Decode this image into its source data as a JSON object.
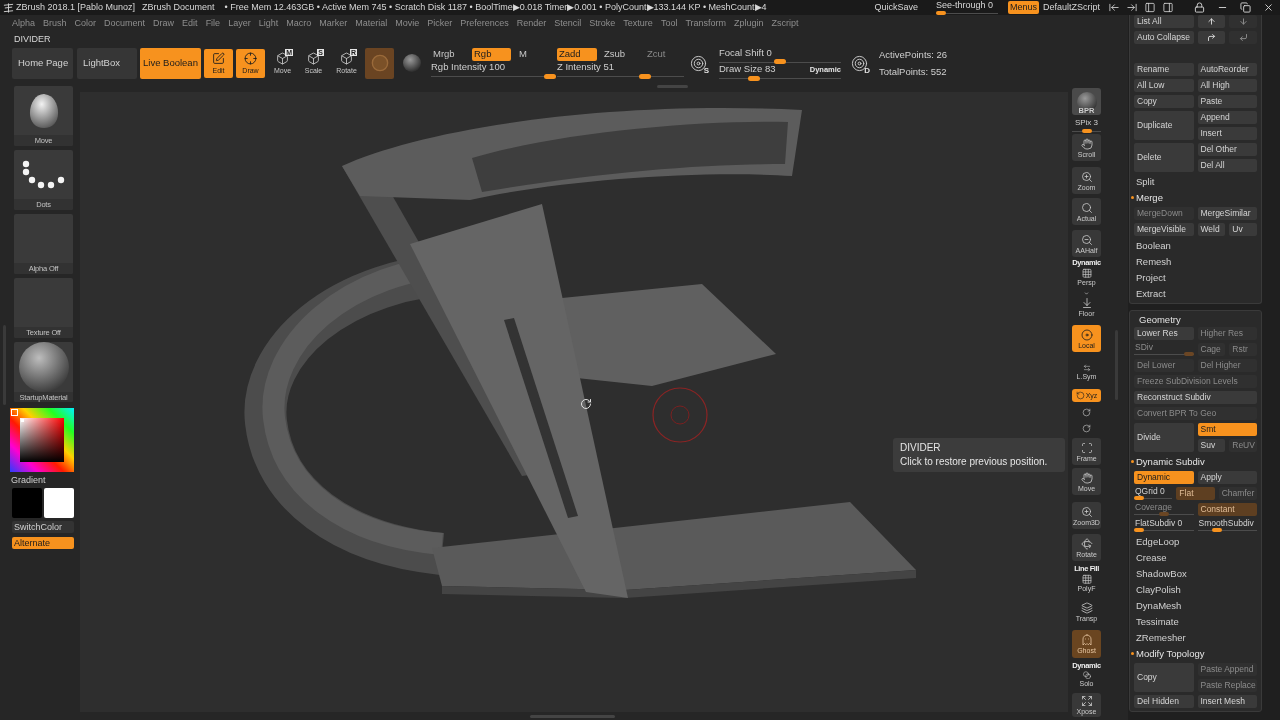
{
  "title_bar": {
    "app": "ZBrush 2018.1 [Pablo Munoz]",
    "document": "ZBrush Document",
    "stats": "• Free Mem 12.463GB • Active Mem 745 • Scratch Disk 1187 • BoolTime▶0.018 Timer▶0.001 • PolyCount▶133.144 KP • MeshCount▶4",
    "quicksave": "QuickSave",
    "see_through": {
      "label": "See-through",
      "value": "0",
      "level": 0
    },
    "menus": {
      "label": "Menus",
      "on": true
    },
    "script": "DefaultZScript"
  },
  "menu_bar": [
    "Alpha",
    "Brush",
    "Color",
    "Document",
    "Draw",
    "Edit",
    "File",
    "Layer",
    "Light",
    "Macro",
    "Marker",
    "Material",
    "Movie",
    "Picker",
    "Preferences",
    "Render",
    "Stencil",
    "Stroke",
    "Texture",
    "Tool",
    "Transform",
    "Zplugin",
    "Zscript"
  ],
  "palette_title": "DIVIDER",
  "toolbar": {
    "nav": [
      {
        "label": "Home Page"
      },
      {
        "label": "LightBox"
      }
    ],
    "live_boolean": {
      "label": "Live Boolean",
      "on": true
    },
    "transform": [
      {
        "kind": "edit",
        "label": "Edit",
        "on": true
      },
      {
        "kind": "draw",
        "label": "Draw",
        "on": true
      },
      {
        "kind": "move",
        "key": "M",
        "label": "Move",
        "on": false
      },
      {
        "kind": "scale",
        "key": "S",
        "label": "Scale",
        "on": false
      },
      {
        "kind": "rotate",
        "key": "R",
        "label": "Rotate",
        "on": false
      }
    ],
    "color_modes": [
      {
        "label": "Mrgb",
        "on": false
      },
      {
        "label": "Rgb",
        "on": true
      },
      {
        "label": "M",
        "on": false
      }
    ],
    "rgb_intensity": {
      "label": "Rgb Intensity",
      "value": "100",
      "level": 1
    },
    "z_modes": [
      {
        "label": "Zadd",
        "on": true,
        "disabled": false
      },
      {
        "label": "Zsub",
        "on": false,
        "disabled": false
      },
      {
        "label": "Zcut",
        "on": false,
        "disabled": true
      }
    ],
    "z_intensity": {
      "label": "Z Intensity",
      "value": "51",
      "level": 0.71
    },
    "focal_key": "S",
    "focal_shift": {
      "label": "Focal Shift",
      "value": "0",
      "level": 0.5
    },
    "draw_size": {
      "label": "Draw Size",
      "value": "83",
      "level": 0.26
    },
    "dynamic": "Dynamic",
    "points_key": "D",
    "points": [
      "ActivePoints: 26",
      "TotalPoints: 552"
    ]
  },
  "left_shelf": {
    "thumbnails": [
      {
        "kind": "brush",
        "label": "Move"
      },
      {
        "kind": "stroke",
        "label": "Dots"
      },
      {
        "kind": "alpha",
        "label": "Alpha Off"
      },
      {
        "kind": "texture",
        "label": "Texture Off"
      },
      {
        "kind": "material",
        "label": "StartupMaterial"
      }
    ],
    "gradient": "Gradient",
    "swatches": [
      {
        "color": "#000000"
      },
      {
        "color": "#ffffff"
      }
    ],
    "switch_color": "SwitchColor",
    "alternate": {
      "label": "Alternate",
      "on": true
    }
  },
  "canvas": {
    "tooltip": {
      "title": "DIVIDER",
      "text": "Click to restore previous position."
    }
  },
  "right_shelf": [
    {
      "kind": "bpr",
      "label": "BPR",
      "on": false,
      "disabled": false
    },
    {
      "kind": "slider",
      "label": "SPix",
      "value": "3",
      "level": 0.5
    },
    {
      "kind": "scroll",
      "label": "Scroll",
      "on": false,
      "disabled": false
    },
    {
      "kind": "zoom",
      "label": "Zoom",
      "on": false,
      "disabled": false
    },
    {
      "kind": "actual",
      "label": "Actual",
      "on": false,
      "disabled": false
    },
    {
      "kind": "aahalf",
      "label": "AAHalf",
      "on": false,
      "disabled": false
    },
    {
      "kind": "persp",
      "caption": "Dynamic",
      "label": "Persp",
      "on": false,
      "disabled": false
    },
    {
      "kind": "floor",
      "label": "Floor",
      "on": false,
      "disabled": false
    },
    {
      "kind": "local",
      "label": "Local",
      "on": true,
      "disabled": false
    },
    {
      "kind": "lsym",
      "label": "L.Sym",
      "on": false,
      "disabled": false
    },
    {
      "kind": "xyz",
      "label": "Xyz",
      "on": true,
      "disabled": false
    },
    {
      "kind": "axis",
      "on": false,
      "disabled": false
    },
    {
      "kind": "axis",
      "on": false,
      "disabled": false
    },
    {
      "kind": "frame",
      "label": "Frame",
      "on": false,
      "disabled": false
    },
    {
      "kind": "move",
      "label": "Move",
      "on": false,
      "disabled": false
    },
    {
      "kind": "zoom3d",
      "label": "Zoom3D",
      "on": false,
      "disabled": false
    },
    {
      "kind": "rotate",
      "label": "Rotate",
      "on": false,
      "disabled": false
    },
    {
      "kind": "polyf",
      "caption": "Line Fill",
      "label": "PolyF",
      "on": false,
      "disabled": false
    },
    {
      "kind": "transp",
      "label": "Transp",
      "on": false,
      "disabled": false
    },
    {
      "kind": "ghost",
      "label": "Ghost",
      "on": true,
      "disabled": true
    },
    {
      "kind": "solo",
      "caption": "Dynamic",
      "label": "Solo",
      "on": false,
      "disabled": false
    },
    {
      "kind": "xpose",
      "label": "Xpose",
      "on": false,
      "disabled": false
    }
  ],
  "panels": [
    {
      "list_controls": [
        {
          "cells": [
            {
              "kind": "button",
              "label": "List All",
              "on": false,
              "disabled": false
            },
            {
              "kind": "up",
              "disabled": false
            },
            {
              "kind": "down",
              "disabled": true
            }
          ]
        },
        {
          "cells": [
            {
              "kind": "button",
              "label": "Auto Collapse",
              "on": false,
              "disabled": false
            },
            {
              "kind": "forward",
              "disabled": false
            },
            {
              "kind": "back",
              "disabled": true
            }
          ]
        }
      ],
      "rows": [
        {
          "kind": "row",
          "cells": [
            {
              "kind": "button",
              "label": "Rename",
              "on": false,
              "disabled": false
            },
            {
              "kind": "button",
              "label": "AutoReorder",
              "on": false,
              "disabled": false
            }
          ]
        },
        {
          "kind": "row",
          "cells": [
            {
              "kind": "button",
              "label": "All Low",
              "on": false,
              "disabled": false
            },
            {
              "kind": "button",
              "label": "All High",
              "on": false,
              "disabled": false
            }
          ]
        },
        {
          "kind": "row",
          "cells": [
            {
              "kind": "button",
              "label": "Copy",
              "on": false,
              "disabled": false
            },
            {
              "kind": "button",
              "label": "Paste",
              "on": false,
              "disabled": false
            }
          ]
        },
        {
          "kind": "tall",
          "main": {
            "kind": "button",
            "label": "Duplicate",
            "on": false,
            "disabled": false
          },
          "stack": [
            [
              {
                "kind": "button",
                "label": "Append",
                "on": false,
                "disabled": false
              }
            ],
            [
              {
                "kind": "button",
                "label": "Insert",
                "on": false,
                "disabled": false
              }
            ]
          ]
        },
        {
          "kind": "tall",
          "main": {
            "kind": "button",
            "label": "Delete",
            "on": false,
            "disabled": false
          },
          "stack": [
            [
              {
                "kind": "button",
                "label": "Del Other",
                "on": false,
                "disabled": false
              }
            ],
            [
              {
                "kind": "button",
                "label": "Del All",
                "on": false,
                "disabled": false
              }
            ]
          ]
        },
        {
          "kind": "sub",
          "label": "Split",
          "expanded": false
        },
        {
          "kind": "sub",
          "label": "Merge",
          "expanded": true
        },
        {
          "kind": "row",
          "cells": [
            {
              "kind": "button",
              "label": "MergeDown",
              "on": false,
              "disabled": true
            },
            {
              "kind": "button",
              "label": "MergeSimilar",
              "on": false,
              "disabled": false
            }
          ]
        },
        {
          "kind": "row",
          "cells": [
            {
              "kind": "button",
              "label": "MergeVisible",
              "on": false,
              "disabled": false
            },
            {
              "kind": "button",
              "label": "Weld",
              "on": false,
              "disabled": false
            },
            {
              "kind": "button",
              "label": "Uv",
              "on": false,
              "disabled": false
            }
          ]
        },
        {
          "kind": "sub",
          "label": "Boolean",
          "expanded": false
        },
        {
          "kind": "sub",
          "label": "Remesh",
          "expanded": false
        },
        {
          "kind": "sub",
          "label": "Project",
          "expanded": false
        },
        {
          "kind": "sub",
          "label": "Extract",
          "expanded": false
        }
      ]
    },
    {
      "title": "Geometry",
      "rows": [
        {
          "kind": "row",
          "cells": [
            {
              "kind": "button",
              "label": "Lower Res",
              "on": false,
              "disabled": false
            },
            {
              "kind": "button",
              "label": "Higher Res",
              "on": false,
              "disabled": true
            }
          ]
        },
        {
          "kind": "row",
          "cells": [
            {
              "kind": "slider",
              "label": "SDiv",
              "level": 1,
              "disabled": true
            },
            {
              "kind": "button",
              "label": "Cage",
              "on": false,
              "disabled": true
            },
            {
              "kind": "button",
              "label": "Rstr",
              "on": false,
              "disabled": true
            }
          ]
        },
        {
          "kind": "row",
          "cells": [
            {
              "kind": "button",
              "label": "Del Lower",
              "on": false,
              "disabled": true
            },
            {
              "kind": "button",
              "label": "Del Higher",
              "on": false,
              "disabled": true
            }
          ]
        },
        {
          "kind": "row",
          "cells": [
            {
              "kind": "button",
              "label": "Freeze SubDivision Levels",
              "on": false,
              "disabled": true
            }
          ]
        },
        {
          "kind": "row",
          "cells": [
            {
              "kind": "button",
              "label": "Reconstruct Subdiv",
              "on": false,
              "disabled": false
            }
          ]
        },
        {
          "kind": "row",
          "cells": [
            {
              "kind": "button",
              "label": "Convert BPR To Geo",
              "on": false,
              "disabled": true
            }
          ]
        },
        {
          "kind": "tall",
          "main": {
            "kind": "button",
            "label": "Divide",
            "on": false,
            "disabled": false
          },
          "stack": [
            [
              {
                "kind": "button",
                "label": "Smt",
                "on": true,
                "disabled": false
              }
            ],
            [
              {
                "kind": "button",
                "label": "Suv",
                "on": false,
                "disabled": false
              },
              {
                "kind": "button",
                "label": "ReUV",
                "on": false,
                "disabled": true
              }
            ]
          ]
        },
        {
          "kind": "sub",
          "label": "Dynamic Subdiv",
          "expanded": true
        },
        {
          "kind": "row",
          "cells": [
            {
              "kind": "button",
              "label": "Dynamic",
              "on": true,
              "disabled": false
            },
            {
              "kind": "button",
              "label": "Apply",
              "on": false,
              "disabled": false
            }
          ]
        },
        {
          "kind": "even",
          "cells": [
            {
              "kind": "slider",
              "label": "QGrid",
              "value": "0",
              "level": 0,
              "disabled": false
            },
            {
              "kind": "button",
              "label": "Flat",
              "on": true,
              "disabled": true
            },
            {
              "kind": "button",
              "label": "Chamfer",
              "on": false,
              "disabled": true
            }
          ]
        },
        {
          "kind": "row",
          "cells": [
            {
              "kind": "slider",
              "label": "Coverage",
              "level": 0.5,
              "disabled": true
            },
            {
              "kind": "button",
              "label": "Constant",
              "on": true,
              "disabled": true
            }
          ]
        },
        {
          "kind": "row",
          "cells": [
            {
              "kind": "slider",
              "label": "FlatSubdiv",
              "value": "0",
              "level": 0,
              "disabled": false
            },
            {
              "kind": "slider",
              "label": "SmoothSubdiv",
              "level": 0.3,
              "disabled": false
            }
          ]
        },
        {
          "kind": "sub",
          "label": "EdgeLoop",
          "expanded": false
        },
        {
          "kind": "sub",
          "label": "Crease",
          "expanded": false
        },
        {
          "kind": "sub",
          "label": "ShadowBox",
          "expanded": false
        },
        {
          "kind": "sub",
          "label": "ClayPolish",
          "expanded": false
        },
        {
          "kind": "sub",
          "label": "DynaMesh",
          "expanded": false
        },
        {
          "kind": "sub",
          "label": "Tessimate",
          "expanded": false
        },
        {
          "kind": "sub",
          "label": "ZRemesher",
          "expanded": false
        },
        {
          "kind": "sub",
          "label": "Modify Topology",
          "expanded": true
        },
        {
          "kind": "tall",
          "main": {
            "kind": "button",
            "label": "Copy",
            "on": false,
            "disabled": false
          },
          "stack": [
            [
              {
                "kind": "button",
                "label": "Paste Append",
                "on": false,
                "disabled": true
              }
            ],
            [
              {
                "kind": "button",
                "label": "Paste Replace",
                "on": false,
                "disabled": true
              }
            ]
          ]
        },
        {
          "kind": "row",
          "cells": [
            {
              "kind": "button",
              "label": "Del Hidden",
              "on": false,
              "disabled": false
            },
            {
              "kind": "button",
              "label": "Insert Mesh",
              "on": false,
              "disabled": false
            }
          ]
        }
      ]
    }
  ]
}
